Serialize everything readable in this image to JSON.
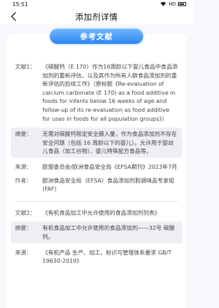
{
  "status": {
    "time": "15:51",
    "net": "HD"
  },
  "nav": {
    "title": "添加剂详情"
  },
  "section": {
    "title": "参考文献"
  },
  "refs": [
    {
      "doc_label": "文献1：",
      "doc_text": "《碳酸钙（E 170）作为16周龄以下婴儿食品中食品添加剂的重新评估，以及其作为所有人群食品添加剂的重新评估的后续工作》（原标题《Re-evaluation of calcium carbonate (E 170) as a food additive in foods for infants below 16 weeks of age and follow-up of its re-evaluation as food additive for uses in foods for all population groups》）",
      "abstract_label": "摘要：",
      "abstract_text": "无需对碳酸钙限定安全摄入量，作为食品添加剂不存在安全问题（包括 16 周龄以下的婴儿）。允许用于婴幼儿食品（加工谷物）、婴儿特殊配方食品等。",
      "source_label": "来源：",
      "source_text": "欧盟委员会/欧洲食品安全局《EFSA期刊》2023年7月",
      "author_label": "作者：",
      "author_text": "欧洲食品安全局（EFSA）食品添加剂和调味品专家组 (FAF)"
    },
    {
      "doc_label": "文献2：",
      "doc_text": "《有机食品加工中允许使用的食品添加剂列表》",
      "abstract_label": "摘要：",
      "abstract_text": "有机食品加工中允许使用的食品添加剂——32号 碳酸钙。",
      "source_label": "来源：",
      "source_text": "《有机产品 生产、加工、标识与管理体系要求 GB/T 19630-2019》"
    }
  ]
}
